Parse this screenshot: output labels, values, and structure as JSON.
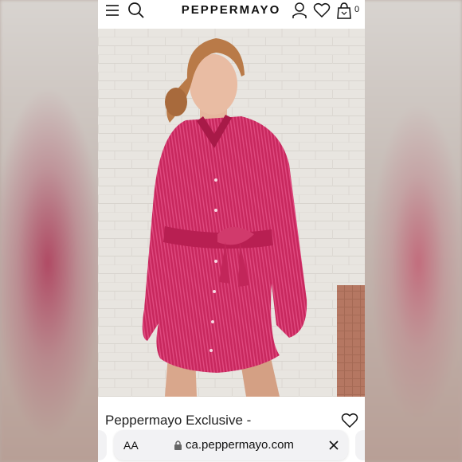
{
  "header": {
    "logo": "PEPPERMAYO",
    "cart_count": "0",
    "icons": [
      "menu-icon",
      "search-icon",
      "account-icon",
      "heart-icon",
      "bag-icon"
    ]
  },
  "product": {
    "title": "Peppermayo Exclusive -",
    "image_count": 6,
    "active_image": 1,
    "dress_color": "#c8285e"
  },
  "browser": {
    "text_size_label": "AA",
    "url": "ca.peppermayo.com"
  },
  "colors": {
    "header_bg": "#ffffff",
    "text": "#111111",
    "address_bar_bg": "#f2f2f4"
  }
}
